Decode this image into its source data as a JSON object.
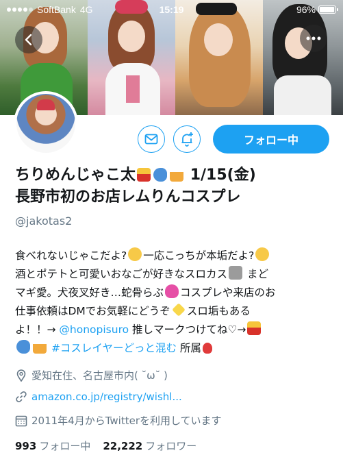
{
  "status_bar": {
    "carrier": "SoftBank",
    "network": "4G",
    "time": "15:19",
    "battery": "96%",
    "battery_level": 0.96
  },
  "profile": {
    "name_line1": "ちりめんじゃこ太",
    "name_date": "1/15(金)",
    "name_line2": "長野市初のお店レムりんコスプレ",
    "handle": "@jakotas2",
    "follow_button": "フォロー中"
  },
  "bio": {
    "line1": "食べれないじゃこだよ?",
    "line1b": "一応こっちが本垢だよ?",
    "line2": "酒とポテトと可愛いおなごが好きなスロカス",
    "line2b": " まど",
    "line3": "マギ愛。犬夜叉好き…蛇骨らぶ",
    "line3b": "コスプレや来店のお",
    "line4": "仕事依頼はDMでお気軽にどうぞ",
    "line4b": "スロ垢もある",
    "line5": "よ！！→ ",
    "mention": "@honopisuro",
    "line5b": " 推しマークつけてね♡→",
    "hashtag": "#コスレイヤーどっと混む",
    "affiliation": " 所属"
  },
  "meta": {
    "location": "愛知在住、名古屋市内( ˘ω˘ )",
    "url": "amazon.co.jp/registry/wishl...",
    "joined": "2011年4月からTwitterを利用しています"
  },
  "counts": {
    "following_count": "993",
    "following_label": "フォロー中",
    "followers_count": "22,222",
    "followers_label": "フォロワー"
  },
  "icons": [
    "back-icon",
    "more-icon",
    "mail-icon",
    "bell-plus-icon",
    "location-icon",
    "link-icon",
    "calendar-icon"
  ]
}
